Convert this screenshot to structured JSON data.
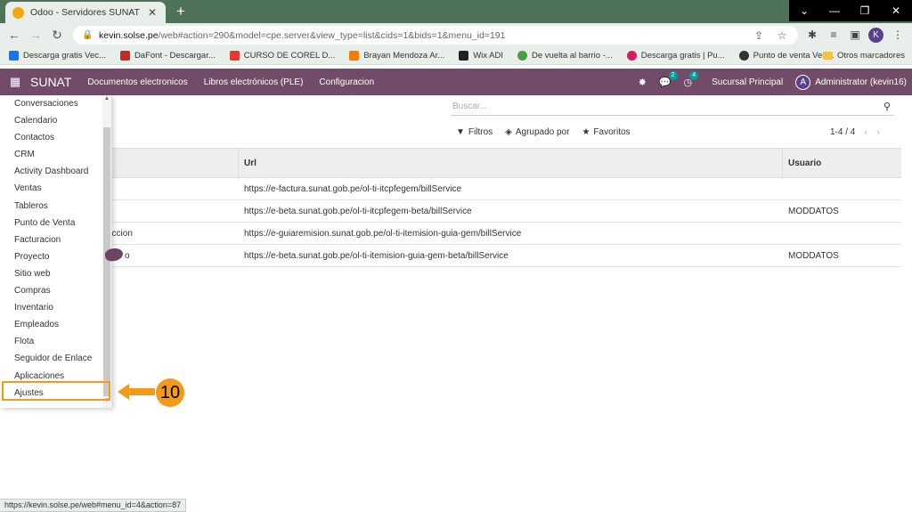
{
  "browser": {
    "tab_title": "Odoo - Servidores SUNAT",
    "url_host": "kevin.solse.pe",
    "url_path": "/web#action=290&model=cpe.server&view_type=list&cids=1&bids=1&menu_id=191",
    "profile_initial": "K",
    "bookmarks": [
      {
        "label": "Descarga gratis Vec...",
        "color": "#1a73e8"
      },
      {
        "label": "DaFont - Descargar...",
        "color": "#c62828"
      },
      {
        "label": "CURSO DE COREL D...",
        "color": "#e53935"
      },
      {
        "label": "Brayan Mendoza Ar...",
        "color": "#f57c00"
      },
      {
        "label": "Wix ADI",
        "color": "#222222"
      },
      {
        "label": "De vuelta al barrio -...",
        "color": "#43a047"
      },
      {
        "label": "Descarga gratis | Pu...",
        "color": "#d81b60"
      },
      {
        "label": "Punto de venta Ven...",
        "color": "#333333"
      }
    ],
    "other_bookmarks": "Otros marcadores",
    "status_url": "https://kevin.solse.pe/web#menu_id=4&action=87"
  },
  "odoo": {
    "brand": "SUNAT",
    "menus": [
      "Documentos electronicos",
      "Libros electrónicos (PLE)",
      "Configuracion"
    ],
    "messages_count": "2",
    "activities_count": "4",
    "company": "Sucursal Principal",
    "user_initial": "A",
    "user": "Administrator (kevin16)"
  },
  "control": {
    "search_placeholder": "Buscar...",
    "filters": "Filtros",
    "group_by": "Agrupado por",
    "favorites": "Favoritos",
    "pager": "1-4 / 4"
  },
  "table": {
    "headers": {
      "url": "Url",
      "user": "Usuario"
    },
    "rows": [
      {
        "name": "",
        "url": "https://e-factura.sunat.gob.pe/ol-ti-itcpfegem/billService",
        "user": ""
      },
      {
        "name": "",
        "url": "https://e-beta.sunat.gob.pe/ol-ti-itcpfegem-beta/billService",
        "user": "MODDATOS"
      },
      {
        "name": "uccion",
        "url": "https://e-guiaremision.sunat.gob.pe/ol-ti-itemision-guia-gem/billService",
        "user": ""
      },
      {
        "name": "o",
        "url": "https://e-beta.sunat.gob.pe/ol-ti-itemision-guia-gem-beta/billService",
        "user": "MODDATOS"
      }
    ]
  },
  "app_menu": [
    "Conversaciones",
    "Calendario",
    "Contactos",
    "CRM",
    "Activity Dashboard",
    "Ventas",
    "Tableros",
    "Punto de Venta",
    "Facturacion",
    "Proyecto",
    "Sitio web",
    "Compras",
    "Inventario",
    "Empleados",
    "Flota",
    "Seguidor de Enlace",
    "Aplicaciones",
    "Ajustes"
  ],
  "annotation": {
    "step": "10",
    "color": "#f39a1b"
  }
}
